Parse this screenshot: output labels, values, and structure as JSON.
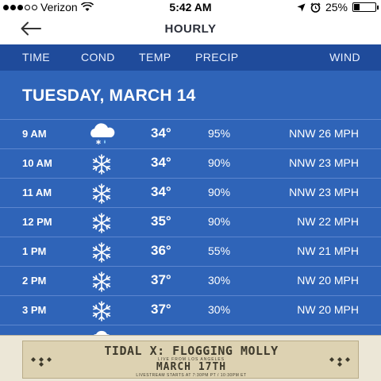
{
  "status_bar": {
    "carrier": "Verizon",
    "time": "5:42 AM",
    "battery_text": "25%",
    "battery_level": 0.25,
    "signal_filled": 3,
    "signal_total": 5
  },
  "header": {
    "title": "HOURLY"
  },
  "columns": {
    "time": "TIME",
    "cond": "COND",
    "temp": "TEMP",
    "precip": "PRECIP",
    "wind": "WIND"
  },
  "date_label": "TUESDAY, MARCH 14",
  "hours": [
    {
      "time": "9 AM",
      "icon": "snow-cloud-icon",
      "temp": "34°",
      "precip": "95%",
      "wind": "NNW 26 MPH"
    },
    {
      "time": "10 AM",
      "icon": "snowflake-icon",
      "temp": "34°",
      "precip": "90%",
      "wind": "NNW 23 MPH"
    },
    {
      "time": "11 AM",
      "icon": "snowflake-icon",
      "temp": "34°",
      "precip": "90%",
      "wind": "NNW 23 MPH"
    },
    {
      "time": "12 PM",
      "icon": "snowflake-icon",
      "temp": "35°",
      "precip": "90%",
      "wind": "NW 22 MPH"
    },
    {
      "time": "1 PM",
      "icon": "snowflake-icon",
      "temp": "36°",
      "precip": "55%",
      "wind": "NW 21 MPH"
    },
    {
      "time": "2 PM",
      "icon": "snowflake-icon",
      "temp": "37°",
      "precip": "30%",
      "wind": "NW 20 MPH"
    },
    {
      "time": "3 PM",
      "icon": "snowflake-icon",
      "temp": "37°",
      "precip": "30%",
      "wind": "NW 20 MPH"
    }
  ],
  "ad": {
    "headline": "TIDAL X: FLOGGING MOLLY",
    "subline": "LIVE FROM LOS ANGELES",
    "date": "MARCH 17TH",
    "tagline": "LIVESTREAM STARTS AT 7:30PM PT / 10:30PM ET",
    "background": "#ddd2b2"
  },
  "colors": {
    "header_band": "#1f4b9b",
    "table_bg": "#2f64b8",
    "divider": "#5c86cf"
  }
}
